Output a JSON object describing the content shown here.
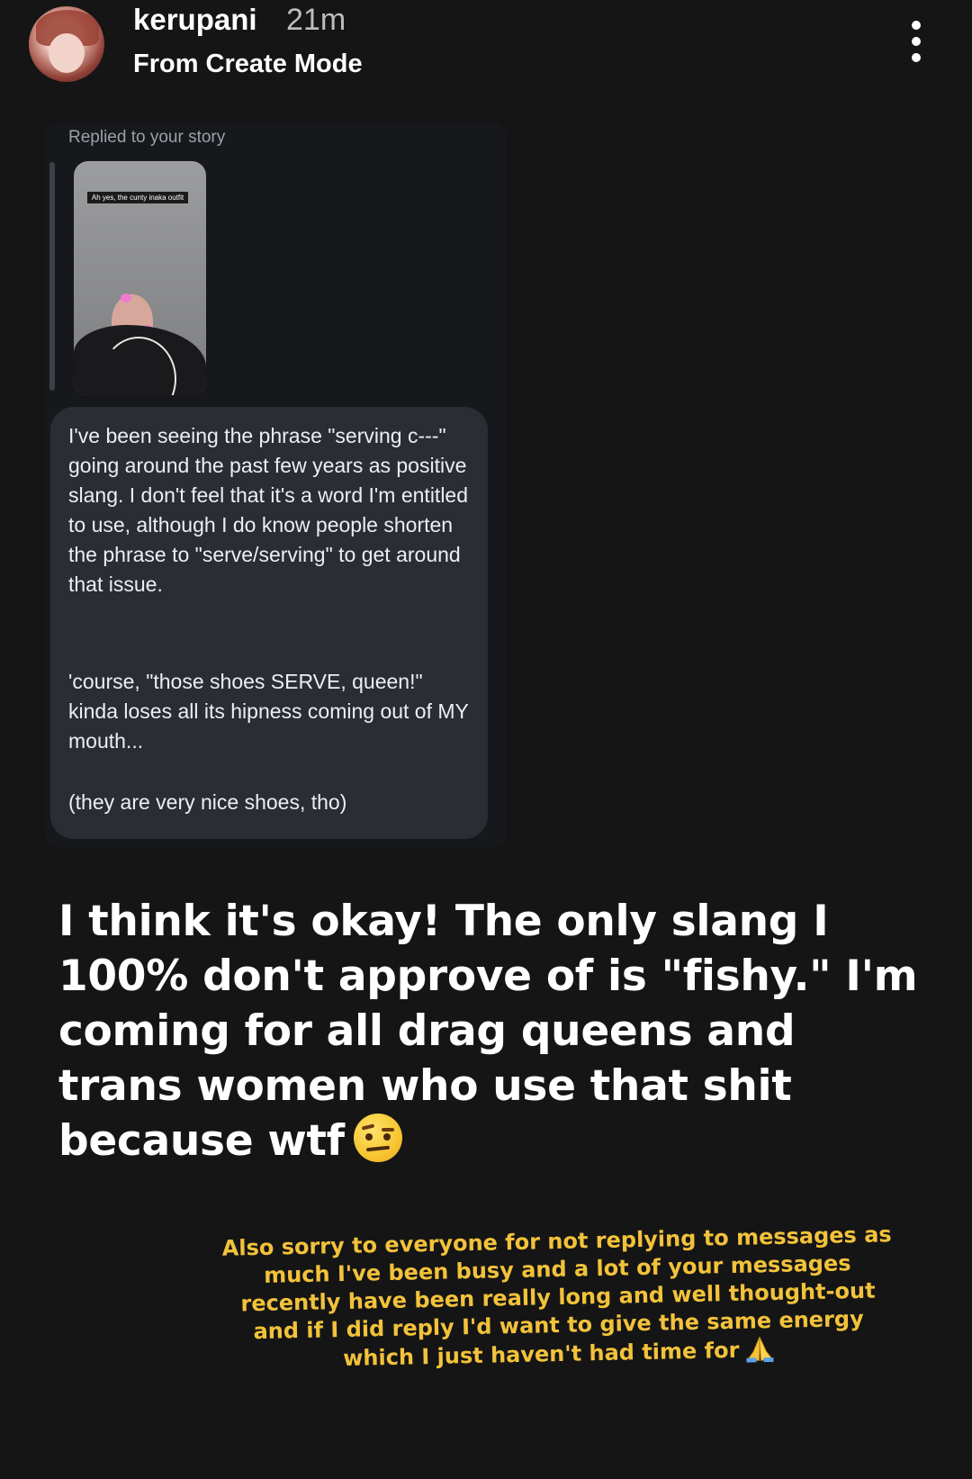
{
  "header": {
    "username": "kerupani",
    "time_ago": "21m",
    "subtitle": "From Create Mode",
    "avatar_icon": "profile-avatar",
    "menu_icon": "more-vertical-icon"
  },
  "reply_card": {
    "caption": "Replied to your story",
    "story_thumbnail_label": "Ah yes, the cunty inaka outfit",
    "message_paragraphs": [
      "I've been seeing the phrase \"serving c---\" going around the past few years as positive slang. I don't feel that it's a word I'm entitled to use, although I do know people shorten the phrase to \"serve/serving\" to get around that issue.",
      "'course, \"those shoes SERVE, queen!\" kinda loses all its hipness coming out of MY mouth...",
      "(they are very nice shoes, tho)"
    ]
  },
  "story_text": {
    "main": "I think it's okay! The only slang I 100% don't approve of is \"fishy.\" I'm coming for all drag queens and trans women who use that shit because wtf",
    "main_emoji": "face-with-raised-eyebrow-icon",
    "note": "Also sorry to everyone for not replying to messages as much I've been busy and a lot of your messages recently have been really long and well thought-out and if I did reply I'd want to give the same energy which I just haven't had time for",
    "note_emoji": "folded-hands-icon",
    "note_color": "#f2c23a"
  }
}
